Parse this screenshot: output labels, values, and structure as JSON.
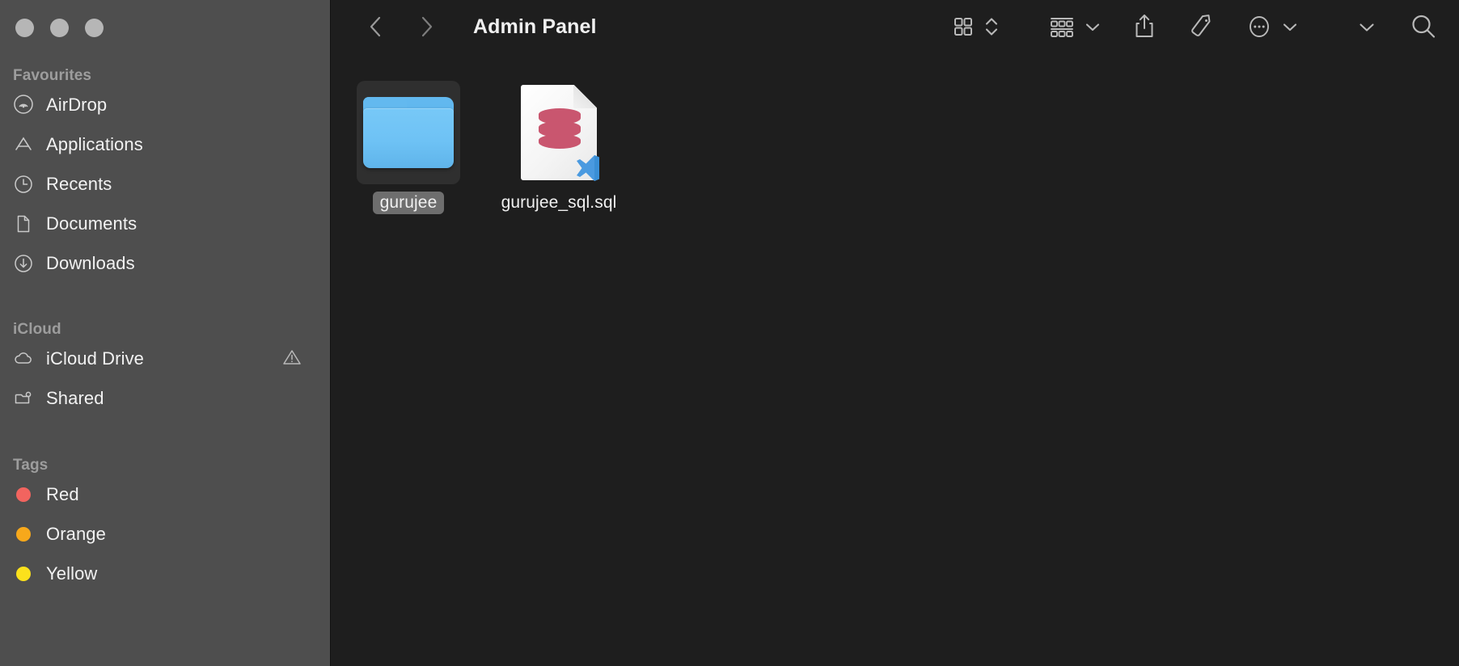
{
  "window": {
    "title": "Admin Panel",
    "traffic_lights": [
      "close",
      "minimize",
      "zoom"
    ],
    "traffic_light_state": "inactive"
  },
  "toolbar": {
    "back_icon": "chevron-left-icon",
    "forward_icon": "chevron-right-icon",
    "view_icon_grid": "grid-view-icon",
    "view_sort_chevrons": "chevron-up-down-icon",
    "group_icon": "group-by-icon",
    "group_chevron": "chevron-down-icon",
    "share_icon": "share-icon",
    "tag_icon": "tag-icon",
    "more_icon": "ellipsis-circle-icon",
    "more_chevron": "chevron-down-icon",
    "extra_chevron": "chevron-down-icon",
    "search_icon": "search-icon"
  },
  "sidebar": {
    "sections": [
      {
        "title": "Favourites",
        "items": [
          {
            "label": "AirDrop",
            "icon": "airdrop-icon"
          },
          {
            "label": "Applications",
            "icon": "applications-icon"
          },
          {
            "label": "Recents",
            "icon": "clock-icon"
          },
          {
            "label": "Documents",
            "icon": "document-icon"
          },
          {
            "label": "Downloads",
            "icon": "download-icon"
          }
        ]
      },
      {
        "title": "iCloud",
        "items": [
          {
            "label": "iCloud Drive",
            "icon": "cloud-icon",
            "trailing_icon": "warning-triangle-icon"
          },
          {
            "label": "Shared",
            "icon": "shared-folder-icon"
          }
        ]
      },
      {
        "title": "Tags",
        "items": [
          {
            "label": "Red",
            "icon": "tag-dot-icon",
            "color": "#f2645f"
          },
          {
            "label": "Orange",
            "icon": "tag-dot-icon",
            "color": "#f7a81b"
          },
          {
            "label": "Yellow",
            "icon": "tag-dot-icon",
            "color": "#fbe11c"
          }
        ]
      }
    ]
  },
  "content": {
    "items": [
      {
        "name": "gurujee",
        "kind": "folder",
        "selected": true
      },
      {
        "name": "gurujee_sql.sql",
        "kind": "sql-file",
        "selected": false,
        "badge": "vscode-badge"
      }
    ]
  },
  "colors": {
    "sidebar_bg": "#4e4e4e",
    "content_bg": "#1e1e1e",
    "selection_bg": "#6e6e6e",
    "folder_blue": "#6ec2f5",
    "database_pink": "#c9566f",
    "vscode_blue": "#3a8fd6"
  }
}
